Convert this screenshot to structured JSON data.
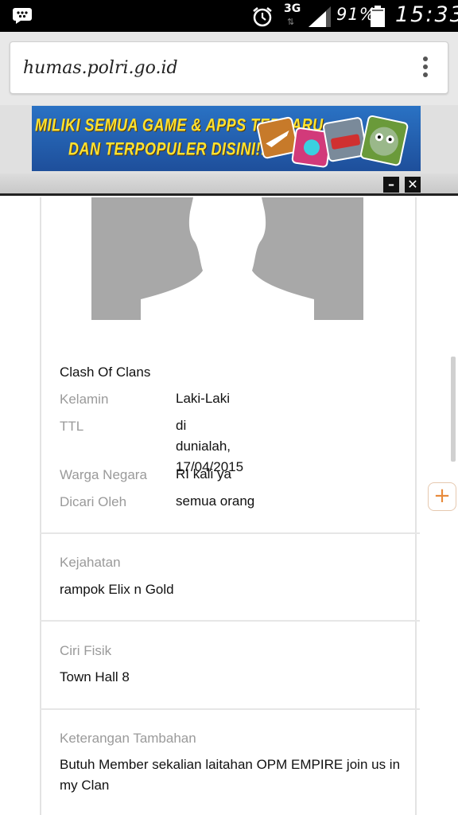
{
  "status_bar": {
    "network": "3G",
    "network_arrows": "⇅",
    "battery_percent": "91%",
    "time": "15:33",
    "icons": [
      "bbm-icon",
      "alarm-icon",
      "signal-icon",
      "battery-icon"
    ]
  },
  "browser": {
    "url": "humas.polri.go.id",
    "menu_icon": "overflow-menu-icon"
  },
  "ad": {
    "line1": "MILIKI SEMUA GAME & APPS TERBARU",
    "line2": "DAN TERPOPULER DISINI!!",
    "minimize_label": "–",
    "close_label": "✕",
    "colors": {
      "background": "#2a72c4",
      "text": "#ffe230"
    }
  },
  "profile": {
    "name": "Clash Of Clans",
    "fields": [
      {
        "label": "Kelamin",
        "value": "Laki-Laki"
      },
      {
        "label": "TTL",
        "value": "di dunialah,\n17/04/2015"
      },
      {
        "label": "Warga Negara",
        "value": "RI kali ya"
      },
      {
        "label": "Dicari Oleh",
        "value": "semua orang"
      }
    ]
  },
  "sections": [
    {
      "label": "Kejahatan",
      "value": "rampok Elix n Gold"
    },
    {
      "label": "Ciri Fisik",
      "value": "Town Hall 8"
    },
    {
      "label": "Keterangan Tambahan",
      "value": "Butuh Member sekalian laitahan OPM EMPIRE join us in my Clan"
    }
  ],
  "floating": {
    "plus_label": "+",
    "accent": "#e88a3a"
  }
}
